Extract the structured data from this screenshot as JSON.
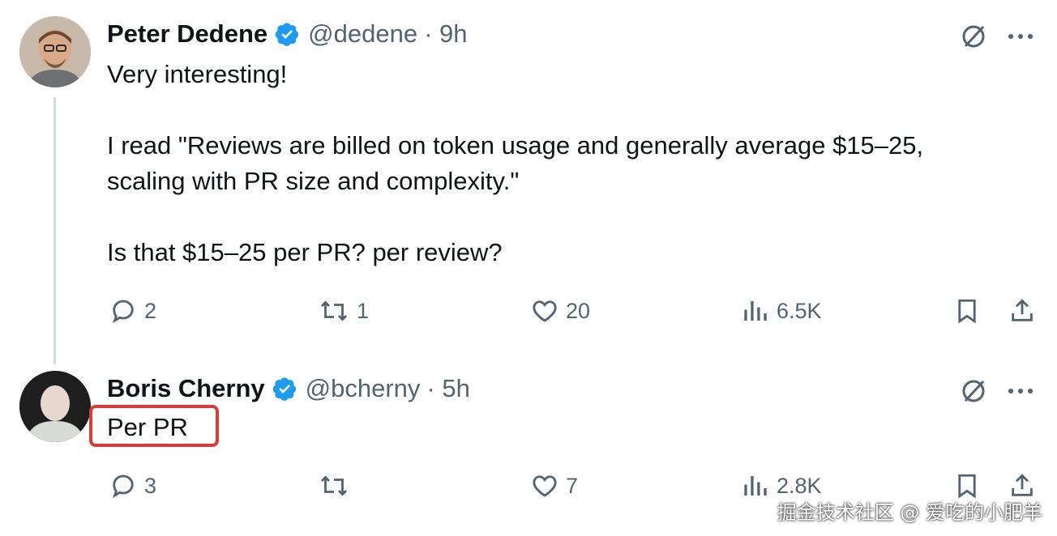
{
  "tweets": [
    {
      "name": "Peter Dedene",
      "handle": "@dedene",
      "time": "· 9h",
      "text": "Very interesting!\n\nI read \"Reviews are billed on token usage and generally average $15–25,\nscaling with PR size and complexity.\"\n\nIs that $15–25 per PR? per review?",
      "replies": "2",
      "reposts": "1",
      "likes": "20",
      "views": "6.5K"
    },
    {
      "name": "Boris Cherny",
      "handle": "@bcherny",
      "time": "· 5h",
      "text": "Per PR",
      "replies": "3",
      "reposts": "",
      "likes": "7",
      "views": "2.8K"
    }
  ],
  "watermark": "掘金技术社区 @ 爱吃的小肥羊",
  "colors": {
    "verified": "#1d9bf0",
    "muted": "#536471",
    "highlight": "#d93a3a"
  }
}
